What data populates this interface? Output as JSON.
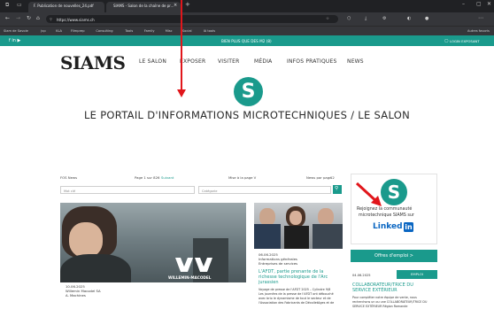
{
  "browser": {
    "tab1_title": "F. Publication de nouvelles_24.pdf",
    "tab2_title": "SIAMS - Salon de la chaîne de pr...",
    "url": "https://www.siams.ch",
    "bookmarks": [
      "Siam de Savoie",
      "jvp",
      "KLA",
      "Filmprep",
      "Consulting",
      "Tools",
      "Family",
      "Misc",
      "Social",
      "IA tools"
    ],
    "bookmarks_right": "Autres favoris"
  },
  "topbar": {
    "center": "BIEN PLUS QUE DES M2 (8)",
    "right": "LOGIN EXPOSANT"
  },
  "nav": {
    "logo": "SIAMS",
    "items": [
      "LE SALON",
      "EXPOSER",
      "VISITER",
      "MÉDIA",
      "INFOS PRATIQUES",
      "NEWS"
    ]
  },
  "hero": {
    "logo_letter": "S",
    "title": "LE PORTAIL D'INFORMATIONS MICROTECHNIQUES / LE SALON"
  },
  "filters": {
    "section_label": "FOS News",
    "page_info": "Page 1 sur 826",
    "page_link": "Suivant",
    "updated": "Mise à la page V",
    "per_page_label": "News par page",
    "per_page_value": "12",
    "search_placeholder": "Mot clé",
    "category_placeholder": "Catégorie"
  },
  "card1": {
    "brand": "WILLEMIN-MACODEL",
    "date": "10.06.2025",
    "company": "Willemin Macodel SA",
    "meta": "A. Machines"
  },
  "card2": {
    "date": "06.06.2025",
    "cat1": "Informations générales",
    "cat2": "Entreprises de services",
    "title1": "L'AFDT, partie prenante de la",
    "title2": "richesse technologique de l'Arc",
    "title3": "jurassien",
    "body1": "Voyage de presse de l'AFDT 2025 – Cylindre 9/8",
    "body2": "Les journées de la presse de l'AFDT ont débouché",
    "body3": "avec brio le dynamisme de tout le secteur et de",
    "body4": "l'Association des Fabricants de DécolletAges et de"
  },
  "sidebar": {
    "logo_letter": "S",
    "join1": "Rejoignez la communauté",
    "join2": "microtechnique SIAMS sur",
    "linkedin_word": "Linked",
    "linkedin_in": "in",
    "offers_button": "Offres d'emploi >",
    "job_date": "04.06.2025",
    "job_badge": "EMPLOI",
    "job_title1": "COLLABORATEUR/TRICE DU",
    "job_title2": "SERVICE EXTÉRIEUR",
    "job_body1": "Pour compléter notre équipe de vente, nous",
    "job_body2": "recherchons un ou une COLLABORATEUR/TRICE DU",
    "job_body3": "SERVICE EXTÉRIEUR Région Romande"
  },
  "colors": {
    "accent": "#1a9a8c",
    "annotation_arrow": "#e1161b"
  }
}
